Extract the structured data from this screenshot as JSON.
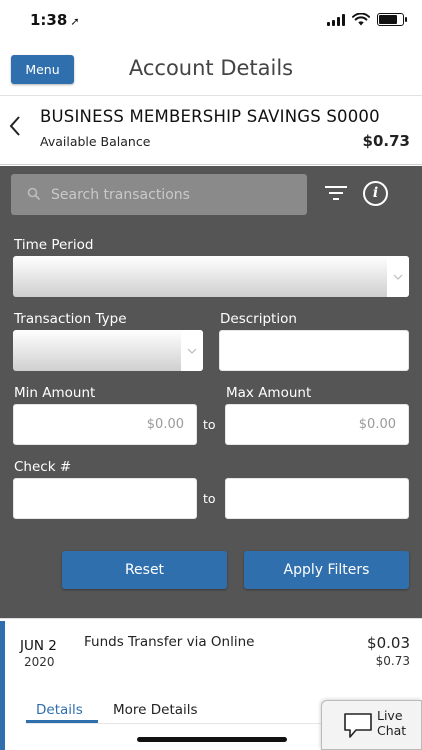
{
  "status_bar": {
    "time": "1:38",
    "location_glyph": "➚",
    "battery_level": 0.8
  },
  "header": {
    "menu_label": "Menu",
    "title": "Account Details"
  },
  "account": {
    "name": "BUSINESS MEMBERSHIP SAVINGS S0000",
    "balance_label": "Available Balance",
    "balance_value": "$0.73"
  },
  "search": {
    "placeholder": "Search transactions"
  },
  "filters": {
    "time_period_label": "Time Period",
    "transaction_type_label": "Transaction Type",
    "description_label": "Description",
    "min_amount_label": "Min Amount",
    "max_amount_label": "Max Amount",
    "min_amount_placeholder": "$0.00",
    "max_amount_placeholder": "$0.00",
    "check_label": "Check #",
    "to_label": "to",
    "reset_label": "Reset",
    "apply_label": "Apply Filters"
  },
  "transaction": {
    "month_day": "JUN 2",
    "year": "2020",
    "description": "Funds Transfer via Online",
    "amount": "$0.03",
    "balance": "$0.73",
    "tabs": [
      "Details",
      "More Details"
    ]
  },
  "live_chat": {
    "label": "Live Chat"
  },
  "colors": {
    "accent": "#2f6fae",
    "panel": "#555555"
  }
}
